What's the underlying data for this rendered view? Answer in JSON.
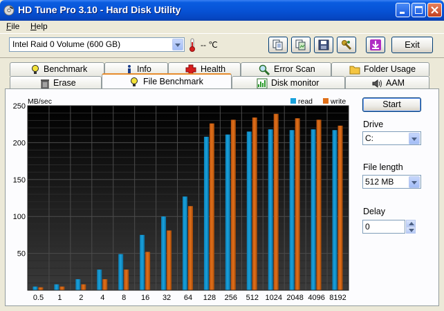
{
  "window": {
    "title": "HD Tune Pro 3.10 - Hard Disk Utility"
  },
  "menu": {
    "file": "F",
    "file_rest": "ile",
    "help": "H",
    "help_rest": "elp"
  },
  "toolbar": {
    "drive": "Intel   Raid 0 Volume (600 GB)",
    "temperature": "-- ℃",
    "exit_label": "Exit"
  },
  "tabs": {
    "row1": [
      "Benchmark",
      "Info",
      "Health",
      "Error Scan",
      "Folder Usage"
    ],
    "row2": [
      "Erase",
      "File Benchmark",
      "Disk monitor",
      "AAM"
    ]
  },
  "controls": {
    "start_label": "Start",
    "drive_label": "Drive",
    "drive_value": "C:",
    "file_length_label": "File length",
    "file_length_value": "512 MB",
    "delay_label": "Delay",
    "delay_value": "0"
  },
  "chart_data": {
    "type": "bar",
    "ylabel": "MB/sec",
    "ylim": [
      0,
      250
    ],
    "yticks": [
      50,
      100,
      150,
      200,
      250
    ],
    "categories": [
      "0.5",
      "1",
      "2",
      "4",
      "8",
      "16",
      "32",
      "64",
      "128",
      "256",
      "512",
      "1024",
      "2048",
      "4096",
      "8192"
    ],
    "series": [
      {
        "name": "read",
        "color": "#1aa2dc",
        "values": [
          5,
          8,
          15,
          28,
          49,
          75,
          100,
          127,
          208,
          211,
          215,
          218,
          217,
          218,
          217
        ]
      },
      {
        "name": "write",
        "color": "#e0701a",
        "values": [
          4,
          5,
          8,
          15,
          28,
          52,
          81,
          114,
          226,
          231,
          234,
          239,
          233,
          231,
          223
        ]
      }
    ],
    "grid": true,
    "legend": "top-right"
  }
}
